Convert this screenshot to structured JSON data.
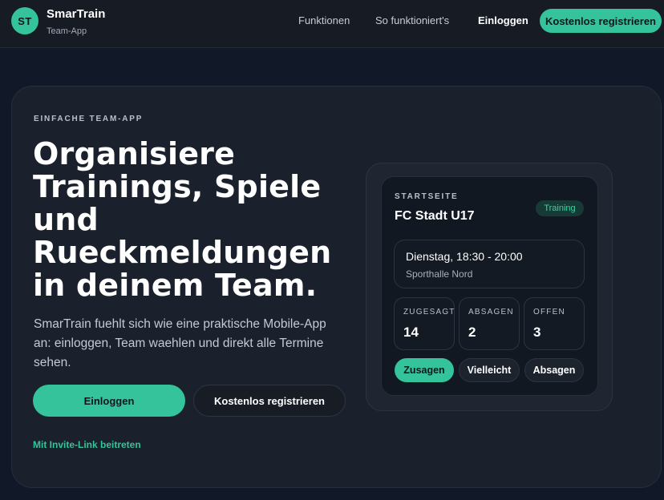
{
  "header": {
    "logo_initials": "ST",
    "brand_name": "SmarTrain",
    "brand_subtitle": "Team-App",
    "nav": {
      "features": "Funktionen",
      "how_it_works": "So funktioniert's",
      "login": "Einloggen",
      "register": "Kostenlos registrieren"
    }
  },
  "hero": {
    "eyebrow": "EINFACHE TEAM-APP",
    "headline": "Organisiere Trainings, Spiele und Rueckmeldungen in deinem Team.",
    "lead": "SmarTrain fuehlt sich wie eine praktische Mobile-App an: einloggen, Team waehlen und direkt alle Termine sehen.",
    "primary_button": "Einloggen",
    "secondary_button": "Kostenlos registrieren",
    "invite_link": "Mit Invite-Link beitreten"
  },
  "phone": {
    "screen_label": "STARTSEITE",
    "team_name": "FC Stadt U17",
    "tag": "Training",
    "event": {
      "time": "Dienstag, 18:30 - 20:00",
      "place": "Sporthalle Nord"
    },
    "stats": [
      {
        "label": "ZUGESAGT",
        "value": "14"
      },
      {
        "label": "ABSAGEN",
        "value": "2"
      },
      {
        "label": "OFFEN",
        "value": "3"
      }
    ],
    "actions": {
      "accept": "Zusagen",
      "maybe": "Vielleicht",
      "decline": "Absagen"
    }
  },
  "colors": {
    "accent": "#34c39a",
    "background": "#111827",
    "card": "#1b212c"
  }
}
